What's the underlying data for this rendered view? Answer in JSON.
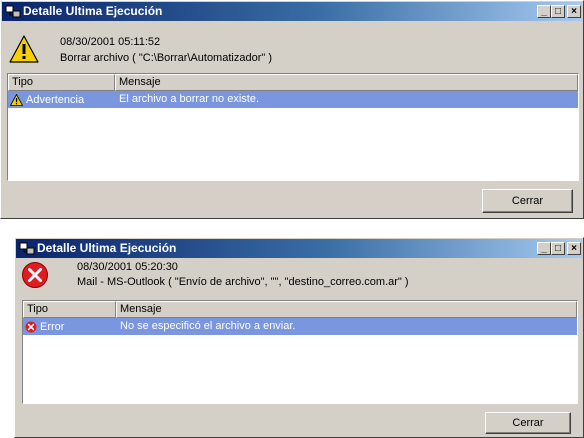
{
  "windows": [
    {
      "title": "Detalle Ultima Ejecución",
      "controls": {
        "minimize": "_",
        "maximize": "□",
        "close": "×"
      },
      "status_icon": "warning-icon",
      "timestamp": "08/30/2001 05:11:52",
      "action": "Borrar archivo ( \"C:\\Borrar\\Automatizador\" )",
      "columns": [
        "Tipo",
        "Mensaje"
      ],
      "rows": [
        {
          "type": "Advertencia",
          "icon": "warning-icon",
          "message": "El archivo a borrar no existe."
        }
      ],
      "close_label": "Cerrar"
    },
    {
      "title": "Detalle Ultima Ejecución",
      "controls": {
        "minimize": "_",
        "maximize": "□",
        "close": "×"
      },
      "status_icon": "error-icon",
      "timestamp": "08/30/2001 05:20:30",
      "action": "Mail - MS-Outlook ( \"Envío de archivo\", \"\", \"destino_correo.com.ar\" )",
      "columns": [
        "Tipo",
        "Mensaje"
      ],
      "rows": [
        {
          "type": "Error",
          "icon": "error-icon",
          "message": "No se especificó el archivo a enviar."
        }
      ],
      "close_label": "Cerrar"
    }
  ],
  "colors": {
    "title_gradient_start": "#0a246a",
    "title_gradient_end": "#a6caf0",
    "selected_row": "#7a96df",
    "face": "#d4d0c8",
    "warning": "#f7d000",
    "error": "#e21b23"
  }
}
